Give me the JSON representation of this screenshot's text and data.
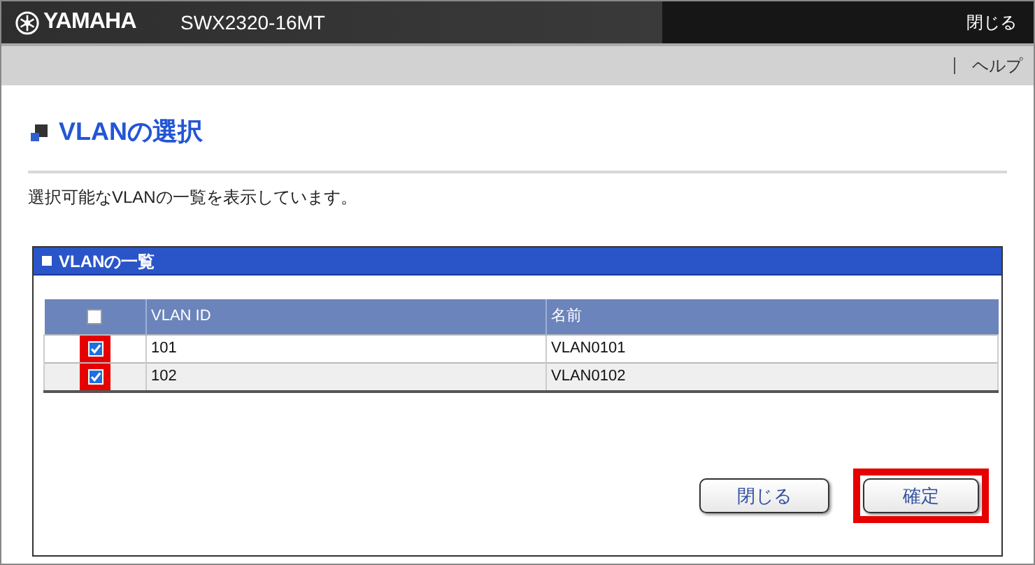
{
  "header": {
    "brand": "YAMAHA",
    "model": "SWX2320-16MT",
    "close_link": "閉じる"
  },
  "toolbar": {
    "help_link": "ヘルプ"
  },
  "page": {
    "title": "VLANの選択",
    "description": "選択可能なVLANの一覧を表示しています。"
  },
  "panel": {
    "title": "VLANの一覧",
    "table": {
      "select_all_checked": false,
      "columns": [
        "VLAN ID",
        "名前"
      ],
      "rows": [
        {
          "checked": true,
          "highlighted": true,
          "cells": [
            "101",
            "VLAN0101"
          ]
        },
        {
          "checked": true,
          "highlighted": true,
          "cells": [
            "102",
            "VLAN0102"
          ]
        }
      ]
    },
    "buttons": [
      {
        "label": "閉じる",
        "highlighted": false
      },
      {
        "label": "確定",
        "highlighted": true
      }
    ]
  }
}
